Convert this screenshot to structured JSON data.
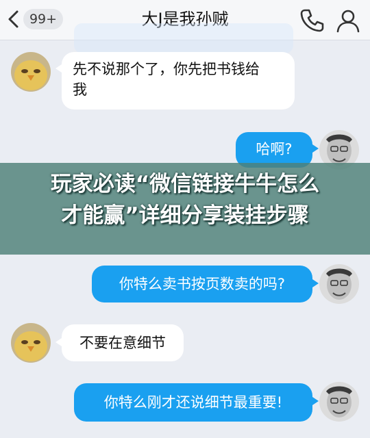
{
  "header": {
    "back_label": "",
    "unread_badge": "99+",
    "title": "大J是我孙贼"
  },
  "messages": [
    {
      "side": "left",
      "text1": "先不说那个了，你先把书钱给",
      "text2": "我"
    },
    {
      "side": "right",
      "text": "哈啊?"
    },
    {
      "side": "right",
      "text": "你特么卖书按页数卖的吗?"
    },
    {
      "side": "left",
      "text": "不要在意细节"
    },
    {
      "side": "right",
      "text": "你特么刚才还说细节最重要!"
    }
  ],
  "overlay": {
    "line1": "玩家必读“微信链接牛牛怎么",
    "line2": "才能赢”详细分享装挂步骤"
  },
  "colors": {
    "right_bubble": "#1aa0f0",
    "left_bubble": "#ffffff",
    "background": "#eaedf3",
    "banner": "#4e8078"
  }
}
